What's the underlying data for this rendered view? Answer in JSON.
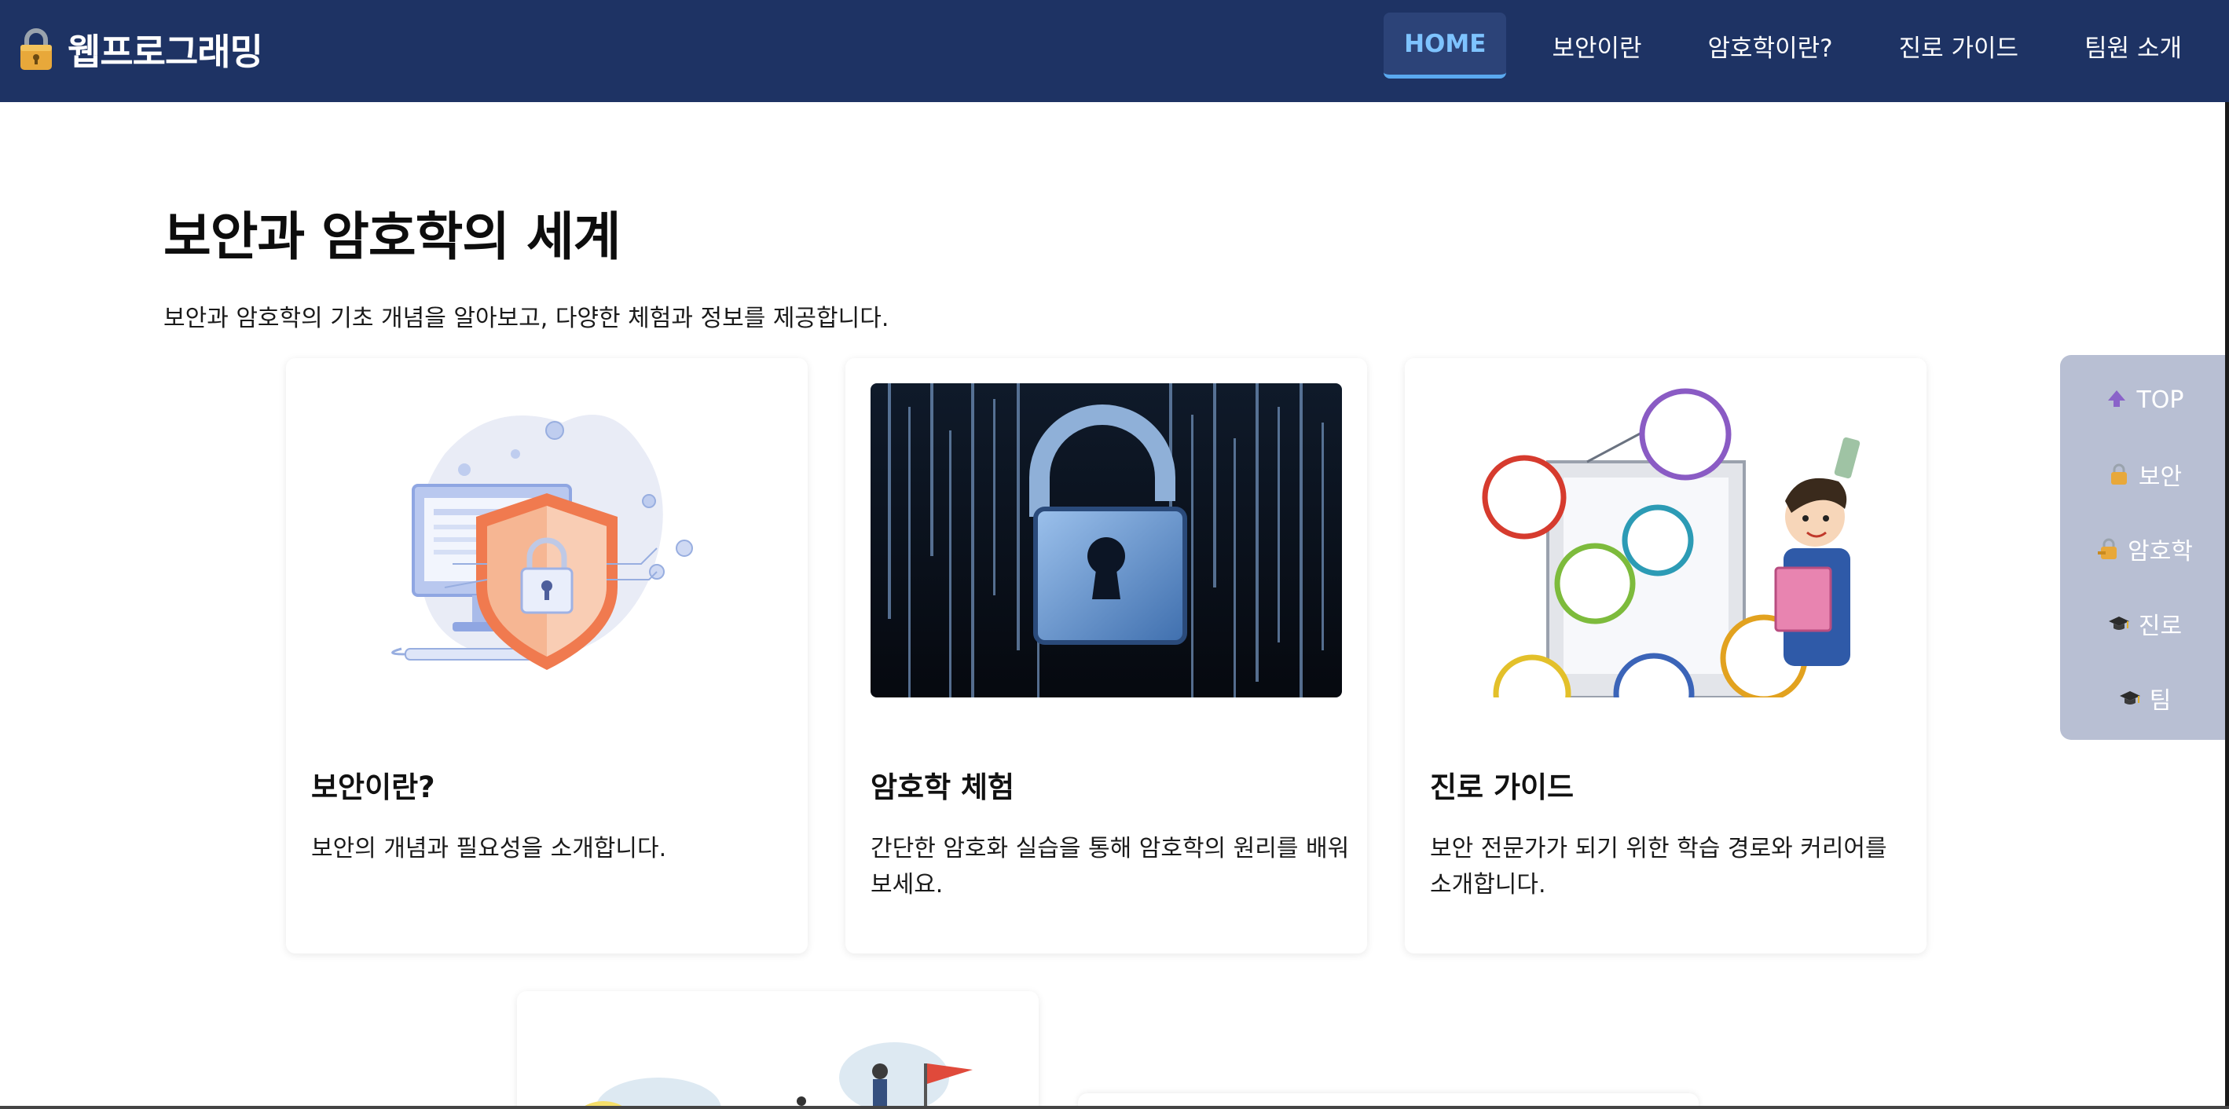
{
  "brand": {
    "title": "웹프로그래밍",
    "icon": "lock-icon"
  },
  "nav": {
    "items": [
      {
        "label": "HOME",
        "active": true
      },
      {
        "label": "보안이란",
        "active": false
      },
      {
        "label": "암호학이란?",
        "active": false
      },
      {
        "label": "진로 가이드",
        "active": false
      },
      {
        "label": "팀원 소개",
        "active": false
      }
    ]
  },
  "hero": {
    "title": "보안과 암호학의 세계",
    "description": "보안과 암호학의 기초 개념을 알아보고, 다양한 체험과 정보를 제공합니다."
  },
  "cards": [
    {
      "title": "보안이란?",
      "text": "보안의 개념과 필요성을 소개합니다.",
      "image": "security-shield-illustration"
    },
    {
      "title": "암호학 체험",
      "text": "간단한 암호화 실습을 통해 암호학의 원리를 배워보세요.",
      "image": "padlock-binary-code-image"
    },
    {
      "title": "진로 가이드",
      "text": "보안 전문가가 되기 위한 학습 경로와 커리어를 소개합니다.",
      "image": "career-roadmap-illustration"
    }
  ],
  "quick_nav": {
    "items": [
      {
        "label": "TOP",
        "icon": "arrow-up-icon"
      },
      {
        "label": "보안",
        "icon": "lock-icon"
      },
      {
        "label": "암호학",
        "icon": "key-lock-icon"
      },
      {
        "label": "진로",
        "icon": "graduation-cap-icon"
      },
      {
        "label": "팀",
        "icon": "graduation-cap-icon"
      }
    ]
  },
  "colors": {
    "header_bg": "#1e3364",
    "nav_active_text": "#7ec3ff",
    "quick_nav_bg": "#b8bfd3"
  }
}
